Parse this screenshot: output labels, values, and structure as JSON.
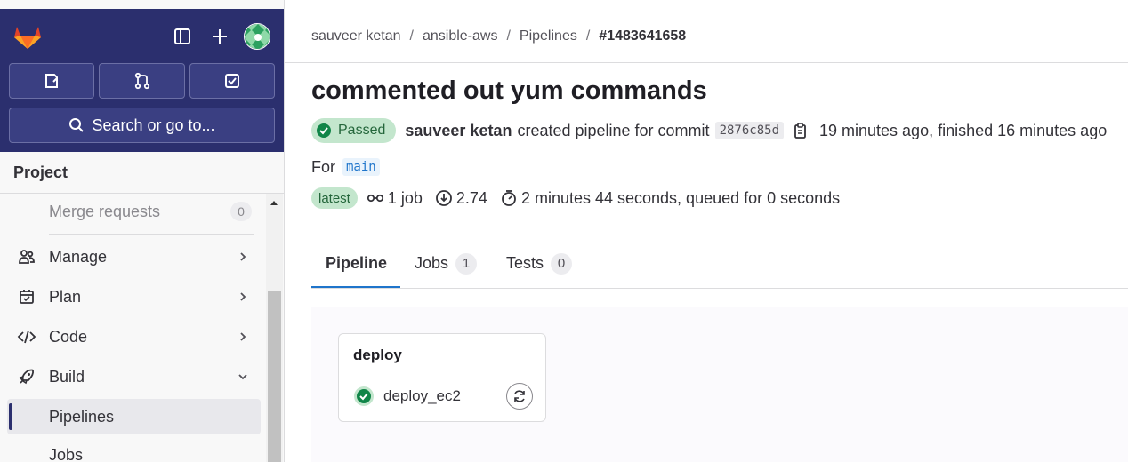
{
  "sidebar": {
    "search_label": "Search or go to...",
    "section_title": "Project",
    "items": [
      {
        "label": "Merge requests",
        "count": "0"
      },
      {
        "label": "Manage"
      },
      {
        "label": "Plan"
      },
      {
        "label": "Code"
      },
      {
        "label": "Build"
      },
      {
        "label": "Pipelines"
      },
      {
        "label": "Jobs"
      }
    ]
  },
  "breadcrumb": [
    "sauveer ketan",
    "ansible-aws",
    "Pipelines",
    "#1483641658"
  ],
  "pipeline": {
    "title": "commented out yum commands",
    "status": "Passed",
    "author": "sauveer ketan",
    "created_text": "created pipeline for commit",
    "sha": "2876c85d",
    "time_text": "19 minutes ago, finished 16 minutes ago",
    "for_label": "For",
    "branch": "main",
    "latest_label": "latest",
    "jobs_text": "1 job",
    "coverage_text": "2.74",
    "duration_text": "2 minutes 44 seconds, queued for 0 seconds"
  },
  "tabs": [
    {
      "label": "Pipeline"
    },
    {
      "label": "Jobs",
      "count": "1"
    },
    {
      "label": "Tests",
      "count": "0"
    }
  ],
  "graph": {
    "stage": "deploy",
    "job": "deploy_ec2"
  },
  "colors": {
    "sidebar_top": "#2b2f6e",
    "passed_bg": "#c3e6cd",
    "passed_fg": "#24663b",
    "success_icon": "#108548",
    "link": "#1f75cb"
  }
}
